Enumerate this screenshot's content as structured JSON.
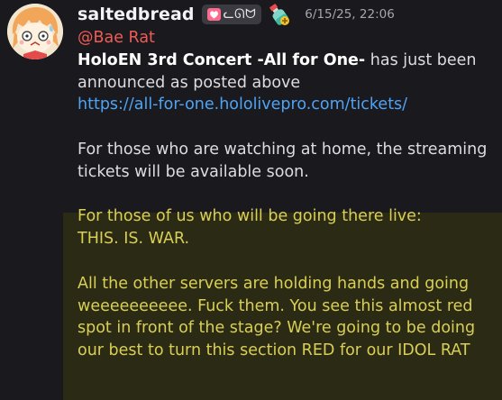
{
  "message": {
    "username": "saltedbread",
    "tag_text": "ᓚᘏᗢ",
    "timestamp": "6/15/25, 22:06",
    "mention": "@Bae Rat",
    "concert_title": "HoloEN 3rd Concert -All for One-",
    "line1_rest": " has just been",
    "line2": "announced as posted above",
    "link": "https://all-for-one.hololivepro.com/tickets/",
    "home_line1": "For those who are watching at home, the streaming",
    "home_line2": "tickets will be available soon.",
    "live_line1": "For those of us who will be going there live:",
    "live_line2": "THIS. IS. WAR.",
    "war_line1": "All the other servers are holding hands and going",
    "war_line2": "weeeeeeeeee. Fuck them. You see this almost red",
    "war_line3": "spot in front of the stage? We're going to be doing",
    "war_line4": "our best to turn this section RED for our IDOL RAT"
  },
  "colors": {
    "background": "#1a1a1e",
    "highlight_background": "#2b2a14",
    "mention": "#f05b55",
    "link": "#4ea3f5",
    "highlight_text": "#d9cf56"
  },
  "icons": {
    "avatar": "anime-character-avatar",
    "tag_icon": "heart-icon",
    "role_icon": "potion-bottle-icon"
  }
}
